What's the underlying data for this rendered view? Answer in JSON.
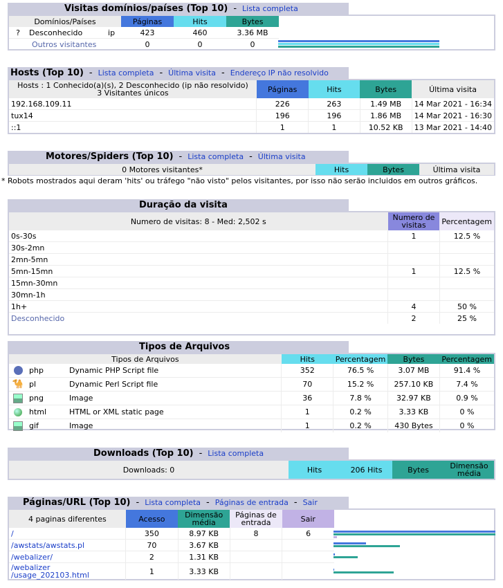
{
  "domains": {
    "title": "Visitas domínios/países (Top 10)",
    "full_list": "Lista completa",
    "headers": {
      "name": "Domínios/Países",
      "pages": "Páginas",
      "hits": "Hits",
      "bytes": "Bytes"
    },
    "rows": [
      {
        "icon": "?",
        "name": "Desconhecido",
        "code": "ip",
        "pages": "423",
        "hits": "460",
        "bytes": "3.36 MB"
      }
    ],
    "others": {
      "name": "Outros visitantes",
      "pages": "0",
      "hits": "0",
      "bytes": "0"
    }
  },
  "hosts": {
    "title": "Hosts (Top 10)",
    "links": [
      "Lista completa",
      "Última visita",
      "Endereço IP não resolvido"
    ],
    "summary_line1": "Hosts : 1 Conhecido(a)(s), 2 Desconhecido (ip não resolvido)",
    "summary_line2": "3 Visitantes únicos",
    "headers": {
      "pages": "Páginas",
      "hits": "Hits",
      "bytes": "Bytes",
      "last": "Última visita"
    },
    "rows": [
      {
        "host": "192.168.109.11",
        "pages": "226",
        "hits": "263",
        "bytes": "1.49 MB",
        "last": "14 Mar 2021 - 16:34"
      },
      {
        "host": "tux14",
        "pages": "196",
        "hits": "196",
        "bytes": "1.86 MB",
        "last": "14 Mar 2021 - 16:30"
      },
      {
        "host": "::1",
        "pages": "1",
        "hits": "1",
        "bytes": "10.52 KB",
        "last": "13 Mar 2021 - 14:40"
      }
    ]
  },
  "robots": {
    "title": "Motores/Spiders (Top 10)",
    "links": [
      "Lista completa",
      "Última visita"
    ],
    "summary": "0 Motores visitantes*",
    "headers": {
      "hits": "Hits",
      "bytes": "Bytes",
      "last": "Última visita"
    },
    "note": "* Robots mostrados aqui deram 'hits' ou tráfego \"não visto\" pelos visitantes, por isso não serão incluidos em outros gráficos."
  },
  "duration": {
    "title": "Duração da visita",
    "summary": "Numero de visitas: 8 - Med: 2,502 s",
    "headers": {
      "count": "Numero de visitas",
      "percent": "Percentagem"
    },
    "rows": [
      {
        "range": "0s-30s",
        "count": "1",
        "percent": "12.5 %"
      },
      {
        "range": "30s-2mn",
        "count": "",
        "percent": ""
      },
      {
        "range": "2mn-5mn",
        "count": "",
        "percent": ""
      },
      {
        "range": "5mn-15mn",
        "count": "1",
        "percent": "12.5 %"
      },
      {
        "range": "15mn-30mn",
        "count": "",
        "percent": ""
      },
      {
        "range": "30mn-1h",
        "count": "",
        "percent": ""
      },
      {
        "range": "1h+",
        "count": "4",
        "percent": "50 %"
      },
      {
        "range": "Desconhecido",
        "count": "2",
        "percent": "25 %"
      }
    ]
  },
  "filetypes": {
    "title": "Tipos de Arquivos",
    "headers": {
      "type": "Tipos de Arquivos",
      "hits": "Hits",
      "percent": "Percentagem",
      "bytes": "Bytes",
      "percent2": "Percentagem"
    },
    "rows": [
      {
        "icon": "php-icon",
        "ext": "php",
        "desc": "Dynamic PHP Script file",
        "hits": "352",
        "percent": "76.5 %",
        "bytes": "3.07 MB",
        "percent2": "91.4 %"
      },
      {
        "icon": "perl-camel-icon",
        "ext": "pl",
        "desc": "Dynamic Perl Script file",
        "hits": "70",
        "percent": "15.2 %",
        "bytes": "257.10 KB",
        "percent2": "7.4 %"
      },
      {
        "icon": "image-icon",
        "ext": "png",
        "desc": "Image",
        "hits": "36",
        "percent": "7.8 %",
        "bytes": "32.97 KB",
        "percent2": "0.9 %"
      },
      {
        "icon": "globe-icon",
        "ext": "html",
        "desc": "HTML or XML static page",
        "hits": "1",
        "percent": "0.2 %",
        "bytes": "3.33 KB",
        "percent2": "0 %"
      },
      {
        "icon": "image-icon",
        "ext": "gif",
        "desc": "Image",
        "hits": "1",
        "percent": "0.2 %",
        "bytes": "430 Bytes",
        "percent2": "0 %"
      }
    ]
  },
  "downloads": {
    "title": "Downloads (Top 10)",
    "full_list": "Lista completa",
    "summary": "Downloads: 0",
    "headers": {
      "hits": "Hits",
      "hits206": "206 Hits",
      "bytes": "Bytes",
      "avg_line1": "Dimensão",
      "avg_line2": "média"
    }
  },
  "pages": {
    "title": "Páginas/URL (Top 10)",
    "links": [
      "Lista completa",
      "Páginas de entrada",
      "Sair"
    ],
    "summary": "4 paginas diferentes",
    "headers": {
      "access": "Acesso",
      "avg_line1": "Dimensão",
      "avg_line2": "média",
      "entry_line1": "Páginas de",
      "entry_line2": "entrada",
      "exit": "Sair"
    },
    "rows": [
      {
        "url_line1": "/",
        "url_line2": "",
        "access": "350",
        "avg": "8.97 KB",
        "entry": "8",
        "exit": "6"
      },
      {
        "url_line1": "/awstats/awstats.pl",
        "url_line2": "",
        "access": "70",
        "avg": "3.67 KB",
        "entry": "",
        "exit": ""
      },
      {
        "url_line1": "/webalizer/",
        "url_line2": "",
        "access": "2",
        "avg": "1.31 KB",
        "entry": "",
        "exit": ""
      },
      {
        "url_line1": "/webalizer",
        "url_line2": "/usage_202103.html",
        "access": "1",
        "avg": "3.33 KB",
        "entry": "",
        "exit": ""
      }
    ]
  },
  "colors": {
    "pages": "#4477dd",
    "hits": "#66ddee",
    "bytes": "#2ea495",
    "visits": "#8888dd",
    "header_bg": "#cccdde",
    "link": "#1a3ec8"
  }
}
